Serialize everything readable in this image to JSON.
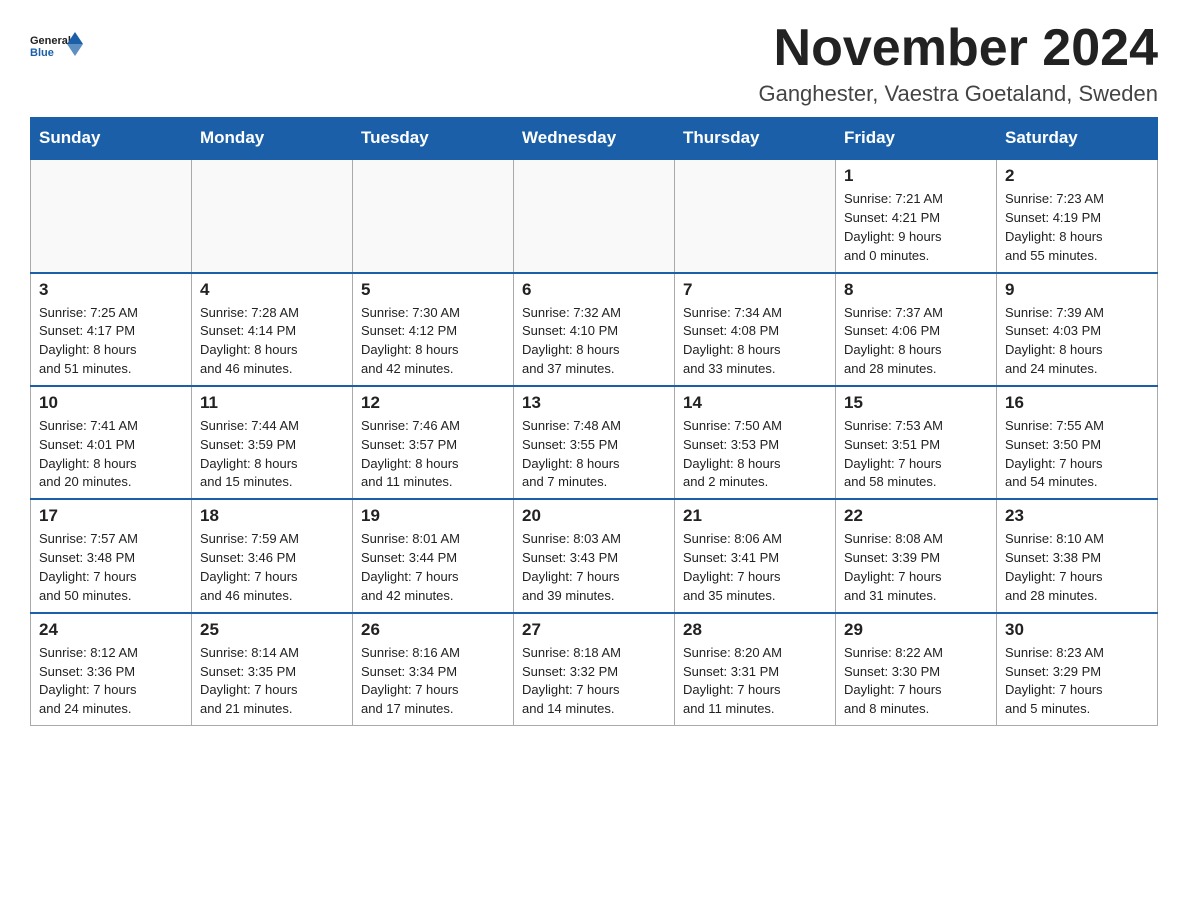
{
  "header": {
    "month_title": "November 2024",
    "location": "Ganghester, Vaestra Goetaland, Sweden"
  },
  "days_of_week": [
    "Sunday",
    "Monday",
    "Tuesday",
    "Wednesday",
    "Thursday",
    "Friday",
    "Saturday"
  ],
  "weeks": [
    [
      {
        "day": "",
        "info": ""
      },
      {
        "day": "",
        "info": ""
      },
      {
        "day": "",
        "info": ""
      },
      {
        "day": "",
        "info": ""
      },
      {
        "day": "",
        "info": ""
      },
      {
        "day": "1",
        "info": "Sunrise: 7:21 AM\nSunset: 4:21 PM\nDaylight: 9 hours\nand 0 minutes."
      },
      {
        "day": "2",
        "info": "Sunrise: 7:23 AM\nSunset: 4:19 PM\nDaylight: 8 hours\nand 55 minutes."
      }
    ],
    [
      {
        "day": "3",
        "info": "Sunrise: 7:25 AM\nSunset: 4:17 PM\nDaylight: 8 hours\nand 51 minutes."
      },
      {
        "day": "4",
        "info": "Sunrise: 7:28 AM\nSunset: 4:14 PM\nDaylight: 8 hours\nand 46 minutes."
      },
      {
        "day": "5",
        "info": "Sunrise: 7:30 AM\nSunset: 4:12 PM\nDaylight: 8 hours\nand 42 minutes."
      },
      {
        "day": "6",
        "info": "Sunrise: 7:32 AM\nSunset: 4:10 PM\nDaylight: 8 hours\nand 37 minutes."
      },
      {
        "day": "7",
        "info": "Sunrise: 7:34 AM\nSunset: 4:08 PM\nDaylight: 8 hours\nand 33 minutes."
      },
      {
        "day": "8",
        "info": "Sunrise: 7:37 AM\nSunset: 4:06 PM\nDaylight: 8 hours\nand 28 minutes."
      },
      {
        "day": "9",
        "info": "Sunrise: 7:39 AM\nSunset: 4:03 PM\nDaylight: 8 hours\nand 24 minutes."
      }
    ],
    [
      {
        "day": "10",
        "info": "Sunrise: 7:41 AM\nSunset: 4:01 PM\nDaylight: 8 hours\nand 20 minutes."
      },
      {
        "day": "11",
        "info": "Sunrise: 7:44 AM\nSunset: 3:59 PM\nDaylight: 8 hours\nand 15 minutes."
      },
      {
        "day": "12",
        "info": "Sunrise: 7:46 AM\nSunset: 3:57 PM\nDaylight: 8 hours\nand 11 minutes."
      },
      {
        "day": "13",
        "info": "Sunrise: 7:48 AM\nSunset: 3:55 PM\nDaylight: 8 hours\nand 7 minutes."
      },
      {
        "day": "14",
        "info": "Sunrise: 7:50 AM\nSunset: 3:53 PM\nDaylight: 8 hours\nand 2 minutes."
      },
      {
        "day": "15",
        "info": "Sunrise: 7:53 AM\nSunset: 3:51 PM\nDaylight: 7 hours\nand 58 minutes."
      },
      {
        "day": "16",
        "info": "Sunrise: 7:55 AM\nSunset: 3:50 PM\nDaylight: 7 hours\nand 54 minutes."
      }
    ],
    [
      {
        "day": "17",
        "info": "Sunrise: 7:57 AM\nSunset: 3:48 PM\nDaylight: 7 hours\nand 50 minutes."
      },
      {
        "day": "18",
        "info": "Sunrise: 7:59 AM\nSunset: 3:46 PM\nDaylight: 7 hours\nand 46 minutes."
      },
      {
        "day": "19",
        "info": "Sunrise: 8:01 AM\nSunset: 3:44 PM\nDaylight: 7 hours\nand 42 minutes."
      },
      {
        "day": "20",
        "info": "Sunrise: 8:03 AM\nSunset: 3:43 PM\nDaylight: 7 hours\nand 39 minutes."
      },
      {
        "day": "21",
        "info": "Sunrise: 8:06 AM\nSunset: 3:41 PM\nDaylight: 7 hours\nand 35 minutes."
      },
      {
        "day": "22",
        "info": "Sunrise: 8:08 AM\nSunset: 3:39 PM\nDaylight: 7 hours\nand 31 minutes."
      },
      {
        "day": "23",
        "info": "Sunrise: 8:10 AM\nSunset: 3:38 PM\nDaylight: 7 hours\nand 28 minutes."
      }
    ],
    [
      {
        "day": "24",
        "info": "Sunrise: 8:12 AM\nSunset: 3:36 PM\nDaylight: 7 hours\nand 24 minutes."
      },
      {
        "day": "25",
        "info": "Sunrise: 8:14 AM\nSunset: 3:35 PM\nDaylight: 7 hours\nand 21 minutes."
      },
      {
        "day": "26",
        "info": "Sunrise: 8:16 AM\nSunset: 3:34 PM\nDaylight: 7 hours\nand 17 minutes."
      },
      {
        "day": "27",
        "info": "Sunrise: 8:18 AM\nSunset: 3:32 PM\nDaylight: 7 hours\nand 14 minutes."
      },
      {
        "day": "28",
        "info": "Sunrise: 8:20 AM\nSunset: 3:31 PM\nDaylight: 7 hours\nand 11 minutes."
      },
      {
        "day": "29",
        "info": "Sunrise: 8:22 AM\nSunset: 3:30 PM\nDaylight: 7 hours\nand 8 minutes."
      },
      {
        "day": "30",
        "info": "Sunrise: 8:23 AM\nSunset: 3:29 PM\nDaylight: 7 hours\nand 5 minutes."
      }
    ]
  ]
}
